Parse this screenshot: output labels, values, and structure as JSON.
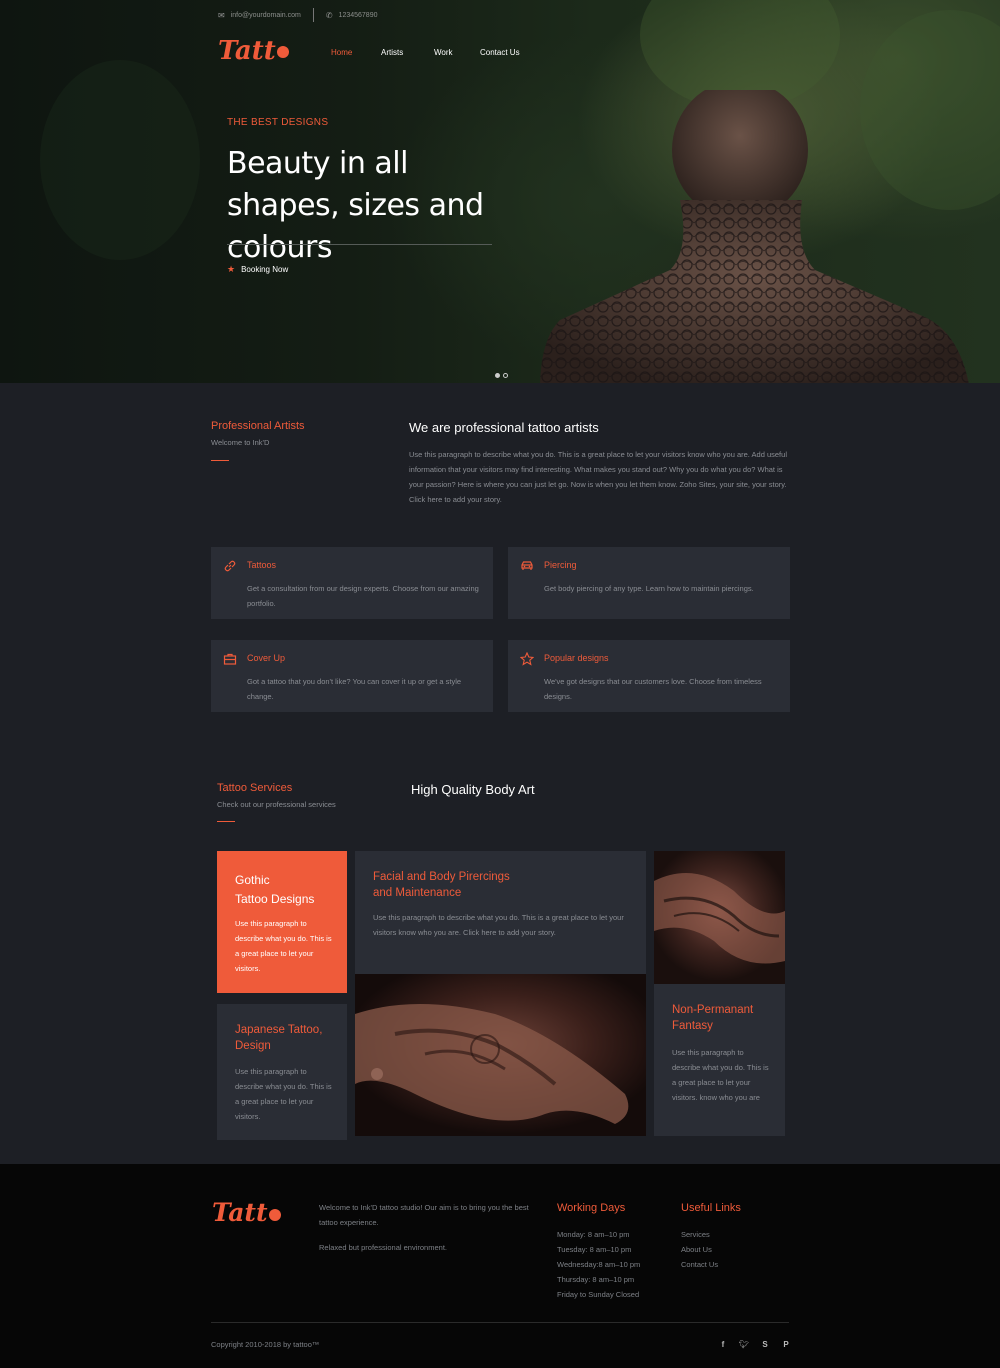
{
  "topbar": {
    "email": "info@yourdomain.com",
    "phone": "1234567890"
  },
  "brand": {
    "logo_text": "Tatt"
  },
  "nav": {
    "items": [
      "Home",
      "Artists",
      "Work",
      "Contact Us"
    ]
  },
  "hero": {
    "eyebrow": "THE BEST DESIGNS",
    "headline": "Beauty in all shapes, sizes and colours",
    "cta": "Booking Now",
    "slide_count": 2,
    "active_slide": 1
  },
  "about": {
    "section_title": "Professional Artists",
    "section_subtitle": "Welcome to Ink'D",
    "heading": "We are professional tattoo artists",
    "paragraph": "Use this paragraph to describe what you do. This is a great place to let your visitors know who you are. Add useful information that your visitors may find interesting. What makes you stand out? Why you do what you do? What is your passion? Here is where you can just let go. Now is when you let them know. Zoho Sites,  your site, your story. Click here to add your story."
  },
  "features": [
    {
      "icon": "link-icon",
      "title": "Tattoos",
      "desc": "Get a consultation from our design experts. Choose from our amazing portfolio."
    },
    {
      "icon": "car-icon",
      "title": "Piercing",
      "desc": "Get body piercing of any type. Learn  how to maintain piercings."
    },
    {
      "icon": "briefcase-icon",
      "title": "Cover Up",
      "desc": "Got a tattoo that you don't like? You can cover it up or get a style change."
    },
    {
      "icon": "star-icon",
      "title": "Popular designs",
      "desc": "We've got designs that our customers love. Choose from timeless designs."
    }
  ],
  "services": {
    "section_title": "Tattoo Services",
    "section_subtitle": "Check out our professional services",
    "heading": "High Quality Body Art",
    "tiles": {
      "gothic": {
        "title": "Gothic\nTattoo Designs",
        "desc": "Use this paragraph to describe what you do. This is a great place to let your visitors."
      },
      "japanese": {
        "title": "Japanese Tattoo, Design",
        "desc": "Use this paragraph to describe what you do. This is a great place to let your visitors."
      },
      "facial": {
        "title": "Facial and Body Pirercings and Maintenance",
        "desc": "Use this paragraph to describe what you do. This is a great place to let your visitors know who you are. Click here to add your story."
      },
      "fantasy": {
        "title": "Non-Permanant Fantasy",
        "desc": "Use this paragraph to describe what you do. This is a great place to let your visitors. know who you are"
      }
    }
  },
  "footer": {
    "logo_text": "Tatt",
    "about_1": "Welcome to Ink'D tattoo studio! Our aim is to bring you the best tattoo experience.",
    "about_2": "Relaxed but professional environment.",
    "working_title": "Working Days",
    "hours": [
      "Monday: 8 am–10 pm",
      "Tuesday: 8 am–10 pm",
      "Wednesday:8 am–10 pm",
      "Thursday: 8 am–10 pm",
      "Friday to Sunday Closed"
    ],
    "links_title": "Useful Links",
    "links": [
      "Services",
      "About Us",
      "Contact Us"
    ],
    "copyright": "Copyright 2010-2018 by tattoo™",
    "social": [
      "facebook-icon",
      "twitter-icon",
      "skype-icon",
      "pinterest-icon"
    ]
  },
  "colors": {
    "accent": "#ef5b3a",
    "background": "#1d1f25",
    "card": "#2a2d35",
    "footer": "#060606"
  }
}
